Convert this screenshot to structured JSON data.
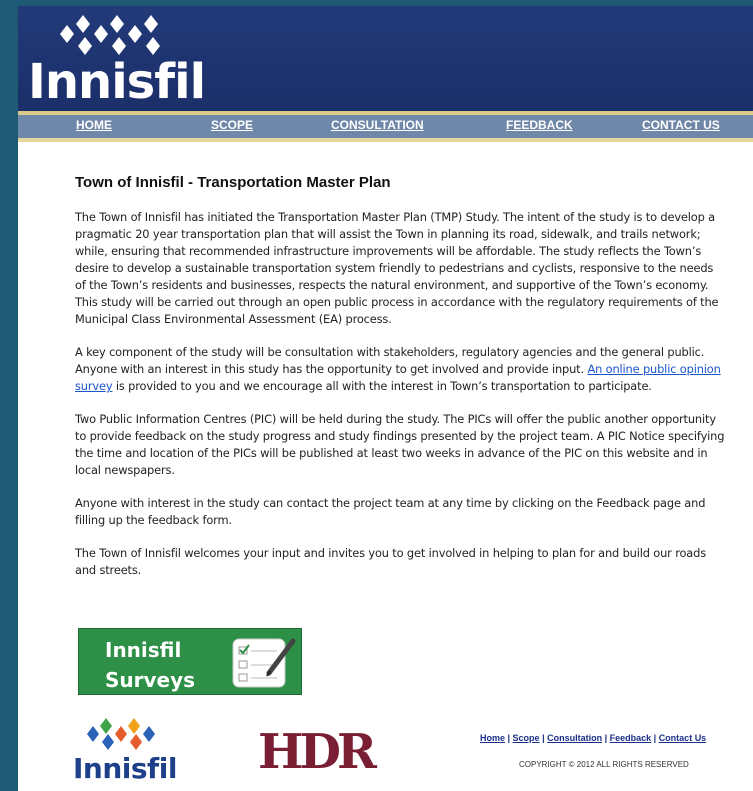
{
  "header": {
    "logo_text": "Innisfil",
    "brand_color": "#223a79",
    "accent_color": "#d9c98b"
  },
  "nav": {
    "items": [
      {
        "label": "HOME"
      },
      {
        "label": "SCOPE"
      },
      {
        "label": "CONSULTATION"
      },
      {
        "label": "FEEDBACK"
      },
      {
        "label": "CONTACT US"
      }
    ]
  },
  "main": {
    "title": "Town of Innisfil - Transportation Master Plan",
    "p1": "The Town of Innisfil has initiated the Transportation Master Plan (TMP) Study. The intent of the study is to develop a pragmatic 20 year transportation plan that will assist the Town in planning its road, sidewalk, and trails network; while, ensuring that recommended infrastructure improvements will be affordable. The study reflects the Town’s desire to develop a sustainable transportation system friendly to pedestrians and cyclists, responsive to the needs of the Town’s residents and businesses, respects the natural environment, and supportive of the Town’s economy. This study will be carried out through an open public process in accordance with the regulatory requirements of the Municipal Class Environmental Assessment (EA) process.",
    "p2_before": "A key component of the study will be consultation with stakeholders, regulatory agencies and the general public. Anyone with an interest in this study has the opportunity to get involved and provide input. ",
    "p2_link": "An online public opinion survey",
    "p2_after": " is provided to you and we encourage all with the interest in Town’s transportation to participate.",
    "p3": "Two Public Information Centres (PIC) will be held during the study. The PICs will offer the public another opportunity to provide feedback on the study progress and study findings presented by the project team. A PIC Notice specifying the time and location of the PICs will be published at least two weeks in advance of the PIC on this website and in local newspapers.",
    "p4": "Anyone with interest in the study can contact the project team at any time by clicking on the Feedback page and filling up the feedback form.",
    "p5": "The Town of Innisfil welcomes your input and invites you to get involved in helping to plan for and build our roads and streets."
  },
  "survey_banner": {
    "line1": "Innisfil",
    "line2": "Surveys",
    "color": "#2e8f47"
  },
  "footer": {
    "logo_text": "Innisfil",
    "partner_logo": "HDR",
    "links": [
      {
        "label": "Home"
      },
      {
        "label": "Scope"
      },
      {
        "label": "Consultation"
      },
      {
        "label": "Feedback"
      },
      {
        "label": "Contact Us"
      }
    ],
    "copyright": "COPYRIGHT © 2012 ALL RIGHTS RESERVED"
  }
}
